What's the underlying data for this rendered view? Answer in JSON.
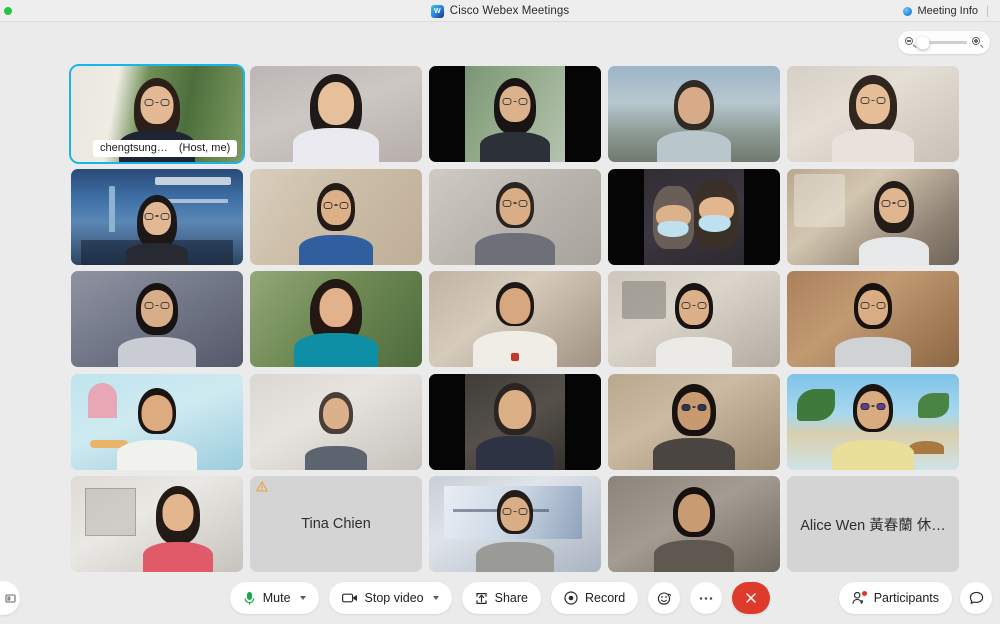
{
  "window": {
    "title": "Cisco Webex Meetings",
    "logo_icon": "webex-logo-icon",
    "status_dot_icon": "green-status-dot-icon",
    "meeting_info_label": "Meeting Info",
    "meeting_info_icon": "info-circle-icon"
  },
  "zoom_control": {
    "zoom_out_icon": "zoom-out-magnifier-icon",
    "zoom_in_icon": "zoom-in-magnifier-icon",
    "value": 5
  },
  "grid": {
    "rows": 5,
    "columns": 5,
    "tiles": [
      {
        "id": "t1",
        "type": "video",
        "active": true,
        "name": "chengtsung…",
        "role": "(Host, me)",
        "bg": "home-greenery"
      },
      {
        "id": "t2",
        "type": "video",
        "active": false,
        "bg": "indoor-white-wall"
      },
      {
        "id": "t3",
        "type": "video",
        "active": false,
        "bg": "outdoor-window-pillarbox"
      },
      {
        "id": "t4",
        "type": "video",
        "active": false,
        "bg": "mountain-sky"
      },
      {
        "id": "t5",
        "type": "video",
        "active": false,
        "bg": "bright-room"
      },
      {
        "id": "t6",
        "type": "video",
        "active": false,
        "bg": "taipei-101-skyline-virtual"
      },
      {
        "id": "t7",
        "type": "video",
        "active": false,
        "bg": "sunlit-wall"
      },
      {
        "id": "t8",
        "type": "video",
        "active": false,
        "bg": "office-grey"
      },
      {
        "id": "t9",
        "type": "video",
        "active": false,
        "bg": "car-interior-masks-pillarbox"
      },
      {
        "id": "t10",
        "type": "video",
        "active": false,
        "bg": "cafe-window"
      },
      {
        "id": "t11",
        "type": "video",
        "active": false,
        "bg": "dim-office"
      },
      {
        "id": "t12",
        "type": "video",
        "active": false,
        "bg": "garden-trees"
      },
      {
        "id": "t13",
        "type": "video",
        "active": false,
        "bg": "living-room"
      },
      {
        "id": "t14",
        "type": "video",
        "active": false,
        "bg": "desk-shelves"
      },
      {
        "id": "t15",
        "type": "video",
        "active": false,
        "bg": "wood-room"
      },
      {
        "id": "t16",
        "type": "video",
        "active": false,
        "bg": "pastel-stairs-virtual"
      },
      {
        "id": "t17",
        "type": "video",
        "active": false,
        "bg": "white-door-room"
      },
      {
        "id": "t18",
        "type": "video",
        "active": false,
        "bg": "dark-room-pillarbox"
      },
      {
        "id": "t19",
        "type": "video",
        "active": false,
        "bg": "tan-wall"
      },
      {
        "id": "t20",
        "type": "video",
        "active": false,
        "bg": "beach-palm-virtual"
      },
      {
        "id": "t21",
        "type": "video",
        "active": false,
        "bg": "modern-interior"
      },
      {
        "id": "t22",
        "type": "placeholder",
        "name": "Tina Chien",
        "warning": true
      },
      {
        "id": "t23",
        "type": "video",
        "active": false,
        "bg": "corporate-backdrop"
      },
      {
        "id": "t24",
        "type": "video",
        "active": false,
        "bg": "dim-wall"
      },
      {
        "id": "t25",
        "type": "placeholder",
        "name": "Alice Wen 黃春蘭 休…",
        "warning": false
      }
    ]
  },
  "toolbar": {
    "mute_label": "Mute",
    "mute_icon": "microphone-icon",
    "stop_video_label": "Stop video",
    "stop_video_icon": "camera-icon",
    "share_label": "Share",
    "share_icon": "share-upload-icon",
    "record_label": "Record",
    "record_icon": "record-circle-icon",
    "reactions_icon": "smiley-reaction-icon",
    "more_icon": "more-ellipsis-icon",
    "end_icon": "end-call-x-icon",
    "participants_label": "Participants",
    "participants_icon": "participants-person-icon",
    "participants_badge": true,
    "chat_icon": "chat-bubble-icon",
    "left_edge_icon": "panel-toggle-icon",
    "end_color": "#df3b2c",
    "mic_color": "#1aa84a"
  }
}
